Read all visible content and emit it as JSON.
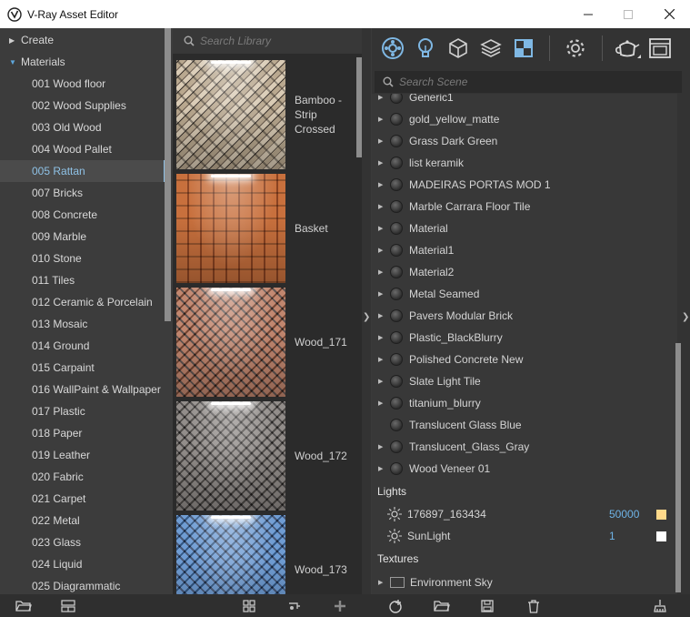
{
  "window": {
    "title": "V-Ray Asset Editor",
    "controls": {
      "minimize": "minimize-icon",
      "maximize": "maximize-icon",
      "close": "close-icon"
    }
  },
  "tree": {
    "items": [
      {
        "label": "Create",
        "kind": "category",
        "expanded": false
      },
      {
        "label": "Materials",
        "kind": "category",
        "expanded": true
      },
      {
        "label": "001 Wood floor"
      },
      {
        "label": "002 Wood Supplies"
      },
      {
        "label": "003 Old Wood"
      },
      {
        "label": "004 Wood Pallet"
      },
      {
        "label": "005 Rattan",
        "selected": true
      },
      {
        "label": "007 Bricks"
      },
      {
        "label": "008 Concrete"
      },
      {
        "label": "009 Marble"
      },
      {
        "label": "010 Stone"
      },
      {
        "label": "011 Tiles"
      },
      {
        "label": "012 Ceramic & Porcelain"
      },
      {
        "label": "013 Mosaic"
      },
      {
        "label": "014 Ground"
      },
      {
        "label": "015 Carpaint"
      },
      {
        "label": "016 WallPaint & Wallpaper"
      },
      {
        "label": "017 Plastic"
      },
      {
        "label": "018 Paper"
      },
      {
        "label": "019 Leather"
      },
      {
        "label": "020 Fabric"
      },
      {
        "label": "021 Carpet"
      },
      {
        "label": "022 Metal"
      },
      {
        "label": "023 Glass"
      },
      {
        "label": "024 Liquid"
      },
      {
        "label": "025 Diagrammatic"
      }
    ]
  },
  "library": {
    "search_placeholder": "Search Library",
    "items": [
      {
        "label_lines": [
          "Bamboo -",
          "Strip",
          "Crossed"
        ],
        "texture": "bamboo"
      },
      {
        "label_lines": [
          "Basket"
        ],
        "texture": "basket"
      },
      {
        "label_lines": [
          "Wood_171"
        ],
        "texture": "171"
      },
      {
        "label_lines": [
          "Wood_172"
        ],
        "texture": "172"
      },
      {
        "label_lines": [
          "Wood_173"
        ],
        "texture": "173"
      }
    ]
  },
  "toolbar": {
    "buttons": [
      {
        "name": "materials-icon",
        "active": true
      },
      {
        "name": "lights-icon"
      },
      {
        "name": "geometry-icon"
      },
      {
        "name": "render-elements-icon"
      },
      {
        "name": "textures-icon"
      },
      {
        "name": "settings-icon"
      },
      {
        "name": "render-teapot-icon"
      },
      {
        "name": "frame-buffer-icon"
      }
    ]
  },
  "scene": {
    "search_placeholder": "Search Scene",
    "materials": [
      {
        "label": "Generic1",
        "expandable": true
      },
      {
        "label": "gold_yellow_matte",
        "expandable": true
      },
      {
        "label": "Grass Dark Green",
        "expandable": true
      },
      {
        "label": "list keramik",
        "expandable": true
      },
      {
        "label": "MADEIRAS PORTAS MOD 1",
        "expandable": true
      },
      {
        "label": "Marble Carrara Floor Tile",
        "expandable": true
      },
      {
        "label": "Material",
        "expandable": true
      },
      {
        "label": "Material1",
        "expandable": true
      },
      {
        "label": "Material2",
        "expandable": true
      },
      {
        "label": "Metal Seamed",
        "expandable": true
      },
      {
        "label": "Pavers Modular Brick",
        "expandable": true
      },
      {
        "label": "Plastic_BlackBlurry",
        "expandable": true
      },
      {
        "label": "Polished Concrete New",
        "expandable": true
      },
      {
        "label": "Slate Light Tile",
        "expandable": true
      },
      {
        "label": "titanium_blurry",
        "expandable": true
      },
      {
        "label": "Translucent Glass Blue",
        "expandable": false
      },
      {
        "label": "Translucent_Glass_Gray",
        "expandable": true
      },
      {
        "label": "Wood Veneer 01",
        "expandable": true
      }
    ],
    "lights_header": "Lights",
    "lights": [
      {
        "label": "176897_163434",
        "intensity": "50000",
        "color": "#ffd98a",
        "icon": "omni-light-icon"
      },
      {
        "label": "SunLight",
        "intensity": "1",
        "color": "#ffffff",
        "icon": "sun-light-icon"
      }
    ],
    "textures_header": "Textures",
    "textures": [
      {
        "label": "Environment Sky",
        "icon": "sky-texture-icon"
      }
    ]
  },
  "bottombar": {
    "buttons": [
      "open-folder-icon",
      "layout-icon",
      "grid-view-icon",
      "filter-icon",
      "add-icon",
      "add-asset-icon",
      "open-file-icon",
      "save-icon",
      "delete-icon",
      "cleanup-icon"
    ]
  },
  "colors": {
    "accent": "#8fc2e6",
    "intensity_text": "#6eb3e6",
    "panel_bg": "#3c3c3c",
    "library_bg": "#2b2b2b"
  }
}
